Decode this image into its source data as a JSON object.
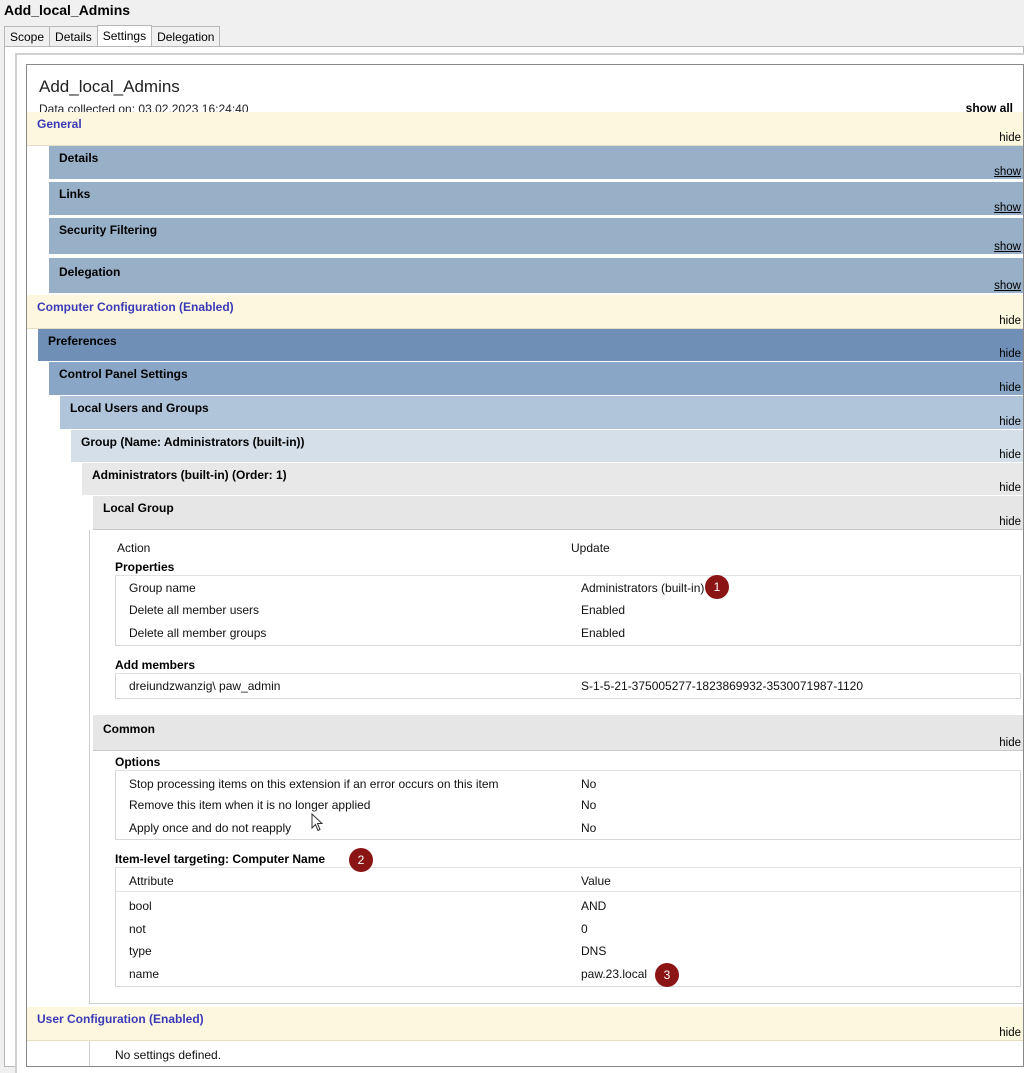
{
  "window": {
    "title": "Add_local_Admins"
  },
  "tabs": [
    {
      "label": "Scope"
    },
    {
      "label": "Details"
    },
    {
      "label": "Settings"
    },
    {
      "label": "Delegation"
    }
  ],
  "report": {
    "title": "Add_local_Admins",
    "collected": "Data collected on: 03.02.2023 16:24:40",
    "show_all": "show all"
  },
  "actions": {
    "hide": "hide",
    "show": "show"
  },
  "sections": {
    "general": "General",
    "details": "Details",
    "links": "Links",
    "security_filtering": "Security Filtering",
    "delegation": "Delegation",
    "computer_config": "Computer Configuration (Enabled)",
    "preferences": "Preferences",
    "control_panel": "Control Panel Settings",
    "local_users_groups": "Local Users and Groups",
    "group_name": "Group (Name: Administrators (built-in))",
    "admin_order": "Administrators (built-in) (Order: 1)",
    "local_group": "Local Group",
    "common": "Common",
    "user_config": "User Configuration (Enabled)"
  },
  "local_group": {
    "action_label": "Action",
    "action_value": "Update",
    "properties_heading": "Properties",
    "properties": [
      {
        "name": "Group name",
        "value": "Administrators (built-in)"
      },
      {
        "name": "Delete all member users",
        "value": "Enabled"
      },
      {
        "name": "Delete all member groups",
        "value": "Enabled"
      }
    ],
    "add_members_heading": "Add members",
    "members": [
      {
        "name": "dreiundzwanzig\\ paw_admin",
        "sid": "S-1-5-21-375005277-1823869932-3530071987-1120"
      }
    ]
  },
  "common": {
    "options_heading": "Options",
    "options": [
      {
        "name": "Stop processing items on this extension if an error occurs on this item",
        "value": "No"
      },
      {
        "name": "Remove this item when it is no longer applied",
        "value": "No"
      },
      {
        "name": "Apply once and do not reapply",
        "value": "No"
      }
    ],
    "ilt_heading": "Item-level targeting: Computer Name",
    "ilt_columns": [
      "Attribute",
      "Value"
    ],
    "ilt_rows": [
      {
        "attr": "bool",
        "value": "AND"
      },
      {
        "attr": "not",
        "value": "0"
      },
      {
        "attr": "type",
        "value": "DNS"
      },
      {
        "attr": "name",
        "value": "paw.23.local"
      }
    ]
  },
  "user_config": {
    "no_settings": "No settings defined."
  },
  "annotations": [
    "1",
    "2",
    "3"
  ],
  "colors": {
    "annotation_badge": "#8b1414",
    "section_title": "#3a3ab8",
    "general_band": "#fef7df"
  }
}
